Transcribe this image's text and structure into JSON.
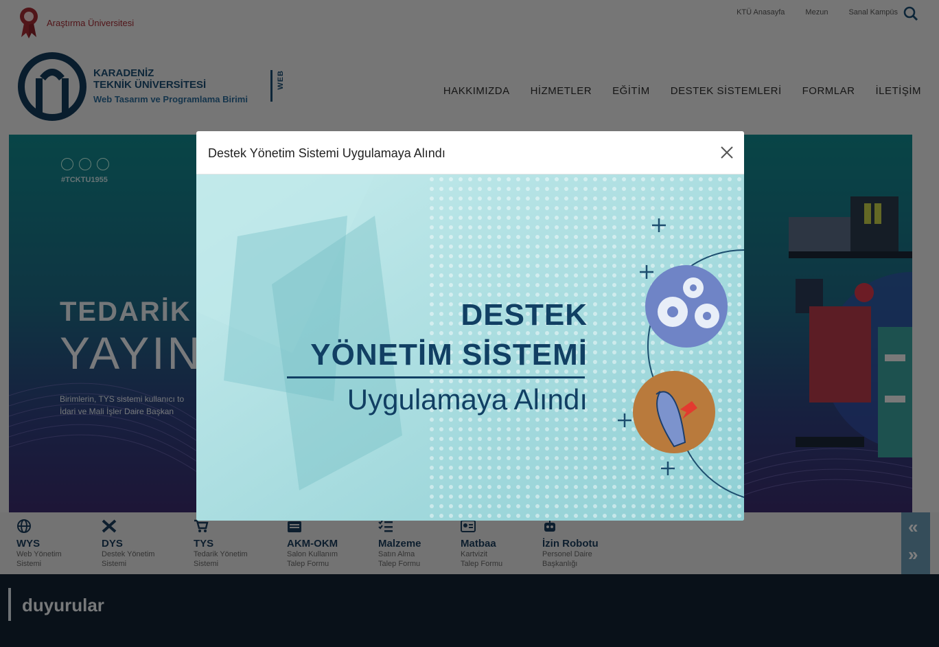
{
  "topbar": {
    "research_label": "Araştırma Üniversitesi",
    "links": [
      "KTÜ Anasayfa",
      "Mezun",
      "Sanal Kampüs"
    ]
  },
  "header": {
    "uni_line1": "KARADENİZ",
    "uni_line2": "TEKNİK ÜNİVERSİTESİ",
    "uni_sub": "Web Tasarım ve Programlama Birimi",
    "web_tag": "WEB",
    "nav": [
      "HAKKIMIZDA",
      "HİZMETLER",
      "EĞİTİM",
      "DESTEK SİSTEMLERİ",
      "FORMLAR",
      "İLETİŞİM"
    ]
  },
  "hero": {
    "hashtag": "#TCKTU1955",
    "title": "TEDARİK",
    "title2": "YAYIN",
    "desc_line1": "Birimlerin, TYS sistemi kullanıcı to",
    "desc_line2": "İdari ve Mali İşler Daire Başkan"
  },
  "quicklinks": [
    {
      "title": "WYS",
      "sub1": "Web Yönetim",
      "sub2": "Sistemi",
      "icon": "globe-icon"
    },
    {
      "title": "DYS",
      "sub1": "Destek Yönetim",
      "sub2": "Sistemi",
      "icon": "tools-icon"
    },
    {
      "title": "TYS",
      "sub1": "Tedarik Yönetim",
      "sub2": "Sistemi",
      "icon": "cart-icon"
    },
    {
      "title": "AKM-OKM",
      "sub1": "Salon Kullanım",
      "sub2": "Talep Formu",
      "icon": "building-icon"
    },
    {
      "title": "Malzeme",
      "sub1": "Satın Alma",
      "sub2": "Talep Formu",
      "icon": "checklist-icon"
    },
    {
      "title": "Matbaa",
      "sub1": "Kartvizit",
      "sub2": "Talep Formu",
      "icon": "id-card-icon"
    },
    {
      "title": "İzin Robotu",
      "sub1": "Personel Daire",
      "sub2": "Başkanlığı",
      "icon": "robot-icon"
    }
  ],
  "quicknav": {
    "prev": "«",
    "next": "»"
  },
  "announcements": {
    "title": "duyurular"
  },
  "modal": {
    "title": "Destek Yönetim Sistemi Uygulamaya Alındı",
    "banner_line1": "DESTEK",
    "banner_line2": "YÖNETİM SİSTEMİ",
    "banner_line3": "Uygulamaya Alındı"
  },
  "colors": {
    "brand": "#1a4d73",
    "research_red": "#a32a32",
    "banner_bg": "#a9dde0",
    "banner_text": "#113f63"
  }
}
